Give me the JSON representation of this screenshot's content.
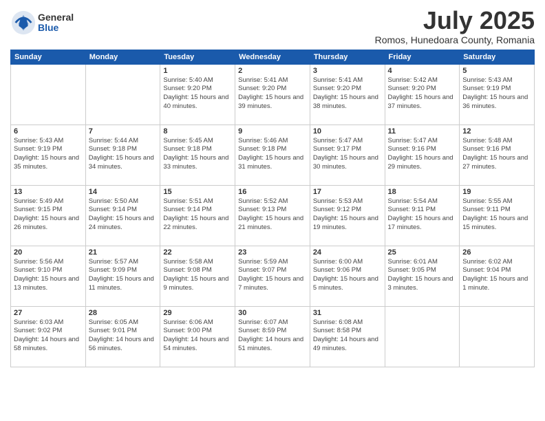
{
  "logo": {
    "general": "General",
    "blue": "Blue"
  },
  "header": {
    "title": "July 2025",
    "subtitle": "Romos, Hunedoara County, Romania"
  },
  "weekdays": [
    "Sunday",
    "Monday",
    "Tuesday",
    "Wednesday",
    "Thursday",
    "Friday",
    "Saturday"
  ],
  "weeks": [
    [
      {
        "day": "",
        "info": ""
      },
      {
        "day": "",
        "info": ""
      },
      {
        "day": "1",
        "info": "Sunrise: 5:40 AM\nSunset: 9:20 PM\nDaylight: 15 hours and 40 minutes."
      },
      {
        "day": "2",
        "info": "Sunrise: 5:41 AM\nSunset: 9:20 PM\nDaylight: 15 hours and 39 minutes."
      },
      {
        "day": "3",
        "info": "Sunrise: 5:41 AM\nSunset: 9:20 PM\nDaylight: 15 hours and 38 minutes."
      },
      {
        "day": "4",
        "info": "Sunrise: 5:42 AM\nSunset: 9:20 PM\nDaylight: 15 hours and 37 minutes."
      },
      {
        "day": "5",
        "info": "Sunrise: 5:43 AM\nSunset: 9:19 PM\nDaylight: 15 hours and 36 minutes."
      }
    ],
    [
      {
        "day": "6",
        "info": "Sunrise: 5:43 AM\nSunset: 9:19 PM\nDaylight: 15 hours and 35 minutes."
      },
      {
        "day": "7",
        "info": "Sunrise: 5:44 AM\nSunset: 9:18 PM\nDaylight: 15 hours and 34 minutes."
      },
      {
        "day": "8",
        "info": "Sunrise: 5:45 AM\nSunset: 9:18 PM\nDaylight: 15 hours and 33 minutes."
      },
      {
        "day": "9",
        "info": "Sunrise: 5:46 AM\nSunset: 9:18 PM\nDaylight: 15 hours and 31 minutes."
      },
      {
        "day": "10",
        "info": "Sunrise: 5:47 AM\nSunset: 9:17 PM\nDaylight: 15 hours and 30 minutes."
      },
      {
        "day": "11",
        "info": "Sunrise: 5:47 AM\nSunset: 9:16 PM\nDaylight: 15 hours and 29 minutes."
      },
      {
        "day": "12",
        "info": "Sunrise: 5:48 AM\nSunset: 9:16 PM\nDaylight: 15 hours and 27 minutes."
      }
    ],
    [
      {
        "day": "13",
        "info": "Sunrise: 5:49 AM\nSunset: 9:15 PM\nDaylight: 15 hours and 26 minutes."
      },
      {
        "day": "14",
        "info": "Sunrise: 5:50 AM\nSunset: 9:14 PM\nDaylight: 15 hours and 24 minutes."
      },
      {
        "day": "15",
        "info": "Sunrise: 5:51 AM\nSunset: 9:14 PM\nDaylight: 15 hours and 22 minutes."
      },
      {
        "day": "16",
        "info": "Sunrise: 5:52 AM\nSunset: 9:13 PM\nDaylight: 15 hours and 21 minutes."
      },
      {
        "day": "17",
        "info": "Sunrise: 5:53 AM\nSunset: 9:12 PM\nDaylight: 15 hours and 19 minutes."
      },
      {
        "day": "18",
        "info": "Sunrise: 5:54 AM\nSunset: 9:11 PM\nDaylight: 15 hours and 17 minutes."
      },
      {
        "day": "19",
        "info": "Sunrise: 5:55 AM\nSunset: 9:11 PM\nDaylight: 15 hours and 15 minutes."
      }
    ],
    [
      {
        "day": "20",
        "info": "Sunrise: 5:56 AM\nSunset: 9:10 PM\nDaylight: 15 hours and 13 minutes."
      },
      {
        "day": "21",
        "info": "Sunrise: 5:57 AM\nSunset: 9:09 PM\nDaylight: 15 hours and 11 minutes."
      },
      {
        "day": "22",
        "info": "Sunrise: 5:58 AM\nSunset: 9:08 PM\nDaylight: 15 hours and 9 minutes."
      },
      {
        "day": "23",
        "info": "Sunrise: 5:59 AM\nSunset: 9:07 PM\nDaylight: 15 hours and 7 minutes."
      },
      {
        "day": "24",
        "info": "Sunrise: 6:00 AM\nSunset: 9:06 PM\nDaylight: 15 hours and 5 minutes."
      },
      {
        "day": "25",
        "info": "Sunrise: 6:01 AM\nSunset: 9:05 PM\nDaylight: 15 hours and 3 minutes."
      },
      {
        "day": "26",
        "info": "Sunrise: 6:02 AM\nSunset: 9:04 PM\nDaylight: 15 hours and 1 minute."
      }
    ],
    [
      {
        "day": "27",
        "info": "Sunrise: 6:03 AM\nSunset: 9:02 PM\nDaylight: 14 hours and 58 minutes."
      },
      {
        "day": "28",
        "info": "Sunrise: 6:05 AM\nSunset: 9:01 PM\nDaylight: 14 hours and 56 minutes."
      },
      {
        "day": "29",
        "info": "Sunrise: 6:06 AM\nSunset: 9:00 PM\nDaylight: 14 hours and 54 minutes."
      },
      {
        "day": "30",
        "info": "Sunrise: 6:07 AM\nSunset: 8:59 PM\nDaylight: 14 hours and 51 minutes."
      },
      {
        "day": "31",
        "info": "Sunrise: 6:08 AM\nSunset: 8:58 PM\nDaylight: 14 hours and 49 minutes."
      },
      {
        "day": "",
        "info": ""
      },
      {
        "day": "",
        "info": ""
      }
    ]
  ]
}
